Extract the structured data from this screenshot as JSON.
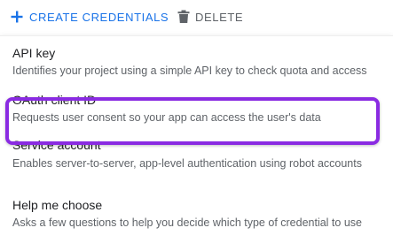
{
  "toolbar": {
    "create_label": "CREATE CREDENTIALS",
    "delete_label": "DELETE",
    "create_icon": "plus-icon",
    "delete_icon": "trash-icon"
  },
  "colors": {
    "accent": "#1a73e8",
    "highlight": "#8a2be2",
    "title_text": "#202124",
    "secondary_text": "#5f6368"
  },
  "menu": {
    "items": [
      {
        "title": "API key",
        "description": "Identifies your project using a simple API key to check quota and access"
      },
      {
        "title": "OAuth client ID",
        "description": "Requests user consent so your app can access the user's data"
      },
      {
        "title": "Service account",
        "description": "Enables server-to-server, app-level authentication using robot accounts"
      },
      {
        "title": "Help me choose",
        "description": "Asks a few questions to help you decide which type of credential to use"
      }
    ]
  }
}
